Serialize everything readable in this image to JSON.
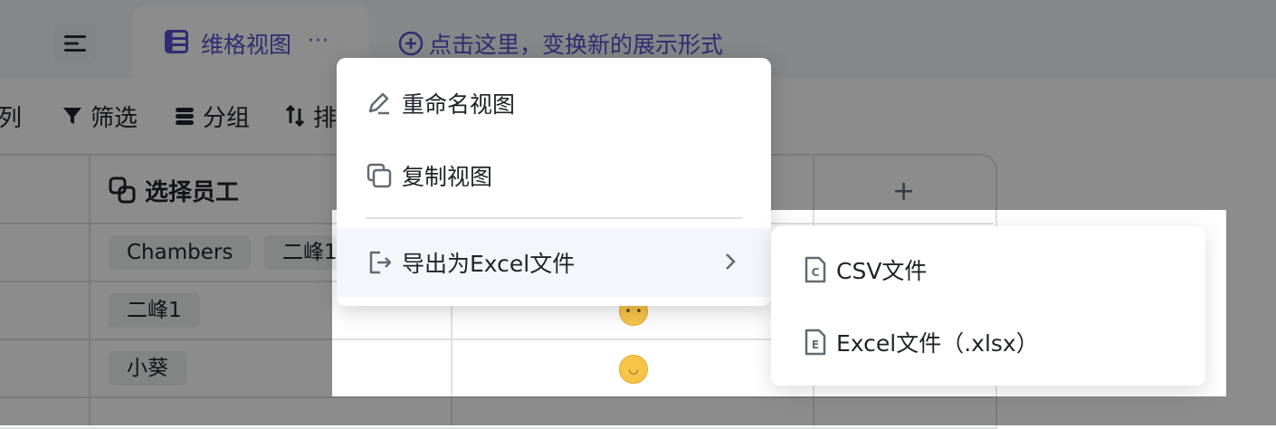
{
  "header": {
    "view_tab": {
      "label": "维格视图",
      "icon": "grid-table-icon",
      "more": "···"
    },
    "add_view": {
      "label": "点击这里，变换新的展示形式",
      "icon": "plus-circle-icon"
    },
    "menu_icon": "hamburger-icon"
  },
  "toolbar": {
    "hidden_cols_label": "隐列",
    "filter_label": "筛选",
    "group_label": "分组",
    "sort_label": "排"
  },
  "table": {
    "column_header": {
      "label": "选择员工",
      "icon": "link-icon"
    },
    "add_column": "+",
    "rows": [
      {
        "members": [
          "Chambers",
          "二峰1"
        ],
        "emoji": "smiley-emoji"
      },
      {
        "members": [
          "二峰1"
        ],
        "emoji": "no-mouth-emoji"
      },
      {
        "members": [
          "小葵"
        ],
        "emoji": "upside-down-emoji"
      }
    ]
  },
  "menu": {
    "items": [
      {
        "label": "重命名视图",
        "icon": "pen-icon"
      },
      {
        "label": "复制视图",
        "icon": "copy-icon"
      },
      {
        "label": "导出为Excel文件",
        "icon": "export-icon",
        "has_submenu": true
      }
    ]
  },
  "submenu": {
    "items": [
      {
        "label": "CSV文件",
        "icon": "csv-file-icon",
        "badge": "C"
      },
      {
        "label": "Excel文件（.xlsx）",
        "icon": "excel-file-icon",
        "badge": "E"
      }
    ]
  },
  "colors": {
    "accent": "#5b4fcf",
    "overlay": "rgba(0,0,0,0.45)",
    "border": "#dee0e3"
  }
}
